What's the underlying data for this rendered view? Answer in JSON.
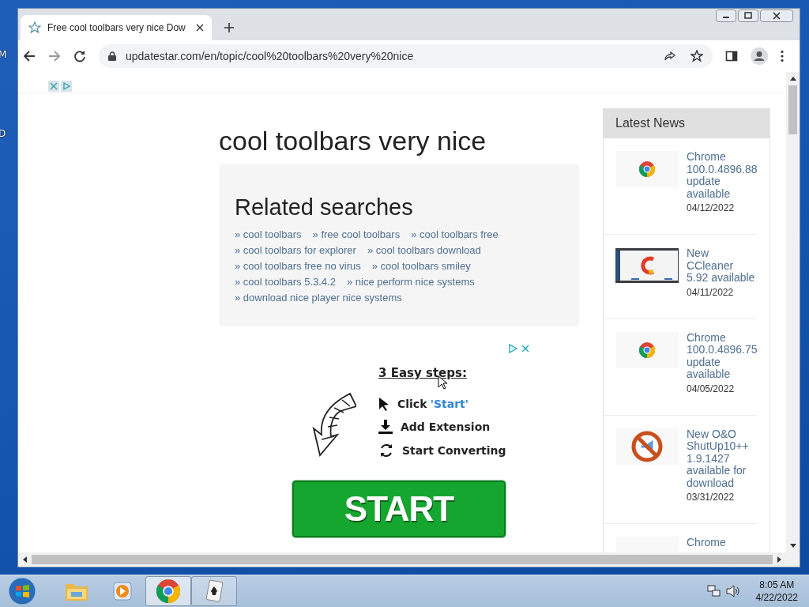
{
  "desktop": {
    "labels": [
      "M",
      "D"
    ]
  },
  "browser": {
    "tab": {
      "title": "Free cool toolbars very nice Dow",
      "selected": true
    },
    "address": "updatestar.com/en/topic/cool%20toolbars%20very%20nice"
  },
  "page": {
    "heading": "cool toolbars very nice",
    "related": {
      "title": "Related searches",
      "rows": [
        [
          "» cool toolbars",
          "» free cool toolbars",
          "» cool toolbars free"
        ],
        [
          "» cool toolbars for explorer",
          "» cool toolbars download"
        ],
        [
          "» cool toolbars free no virus",
          "» cool toolbars smiley"
        ],
        [
          "» cool toolbars 5.3.4.2",
          "» nice perform nice systems"
        ],
        [
          "» download nice player nice systems"
        ]
      ]
    },
    "ad": {
      "title": "3 Easy steps:",
      "steps": [
        {
          "kind": "pointer",
          "text": "Click",
          "accent": "'Start'"
        },
        {
          "kind": "download",
          "text": "Add Extension"
        },
        {
          "kind": "refresh",
          "text": "Start Converting"
        }
      ],
      "button": "START"
    },
    "news": {
      "title": "Latest News",
      "items": [
        {
          "kind": "chrome",
          "title": "Chrome 100.0.4896.88 update available",
          "date": "04/12/2022"
        },
        {
          "kind": "screenshot",
          "title": "New CCleaner 5.92 available",
          "date": "04/11/2022"
        },
        {
          "kind": "chrome",
          "title": "Chrome 100.0.4896.75 update available",
          "date": "04/05/2022"
        },
        {
          "kind": "blocked",
          "title": "New O&O ShutUp10++ 1.9.1427 available for download",
          "date": "03/31/2022"
        },
        {
          "kind": "blank",
          "title": "Chrome"
        }
      ]
    }
  },
  "taskbar": {
    "apps": [
      {
        "kind": "folder",
        "running": false,
        "selected": false
      },
      {
        "kind": "media",
        "running": false,
        "selected": false
      },
      {
        "kind": "chrome",
        "running": true,
        "selected": true
      },
      {
        "kind": "cards",
        "running": true,
        "selected": false
      }
    ],
    "time": "8:05 AM",
    "date": "4/22/2022"
  }
}
